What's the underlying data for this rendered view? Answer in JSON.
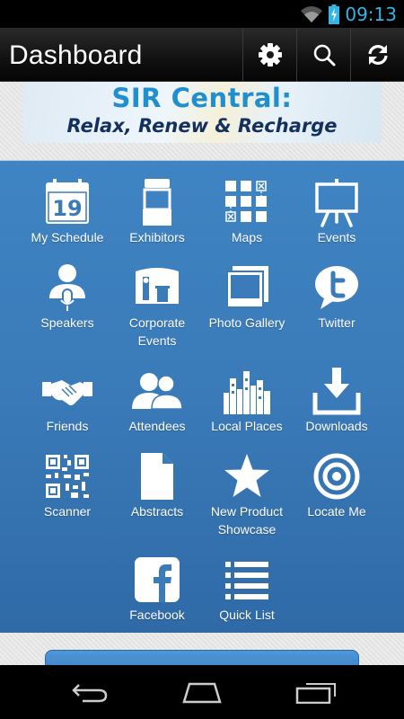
{
  "status_bar": {
    "time": "09:13",
    "accent_color": "#33b5e5"
  },
  "header": {
    "title": "Dashboard",
    "buttons": [
      "gear-icon",
      "search-icon",
      "refresh-icon"
    ]
  },
  "banner": {
    "line1": "SIR Central:",
    "line2": "Relax, Renew & Recharge"
  },
  "tiles": [
    {
      "label": "My Schedule",
      "icon": "calendar-icon",
      "date": "19"
    },
    {
      "label": "Exhibitors",
      "icon": "booth-icon"
    },
    {
      "label": "Maps",
      "icon": "map-grid-icon"
    },
    {
      "label": "Events",
      "icon": "easel-icon"
    },
    {
      "label": "Speakers",
      "icon": "speaker-icon"
    },
    {
      "label": "Corporate\nEvents",
      "label_line1": "Corporate",
      "label_line2": "Events",
      "icon": "corporate-booth-icon"
    },
    {
      "label": "Photo Gallery",
      "icon": "photo-icon"
    },
    {
      "label": "Twitter",
      "icon": "twitter-icon"
    },
    {
      "label": "Friends",
      "icon": "handshake-icon"
    },
    {
      "label": "Attendees",
      "icon": "people-icon"
    },
    {
      "label": "Local Places",
      "icon": "skyline-icon"
    },
    {
      "label": "Downloads",
      "icon": "download-icon"
    },
    {
      "label": "Scanner",
      "icon": "qr-code-icon"
    },
    {
      "label": "Abstracts",
      "icon": "document-icon"
    },
    {
      "label_line1": "New Product",
      "label_line2": "Showcase",
      "icon": "star-icon"
    },
    {
      "label": "Locate Me",
      "icon": "target-icon"
    },
    {
      "label": "Facebook",
      "icon": "facebook-icon"
    },
    {
      "label": "Quick List",
      "icon": "list-icon"
    }
  ],
  "colors": {
    "grid_background": "#3a7ab8",
    "header_background": "#111111"
  }
}
